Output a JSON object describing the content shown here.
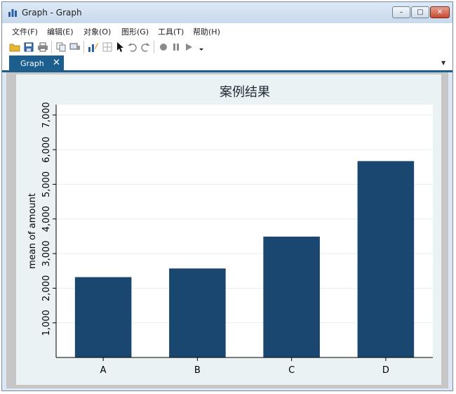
{
  "window": {
    "title": "Graph - Graph"
  },
  "window_controls": {
    "minimize": "–",
    "maximize": "□",
    "close": "✕"
  },
  "menu": [
    "文件(F)",
    "编辑(E)",
    "对象(O)",
    "图形(G)",
    "工具(T)",
    "帮助(H)"
  ],
  "toolbar_icons": [
    "open-folder-icon",
    "save-icon",
    "print-icon",
    "copy-icon",
    "screen-icon",
    "graph-editor-icon",
    "data-editor-icon",
    "pointer-icon",
    "undo-icon",
    "redo-icon",
    "record-icon",
    "pause-icon",
    "play-icon",
    "dropdown-icon"
  ],
  "tabs": [
    {
      "label": "Graph",
      "close": "✕"
    }
  ],
  "tab_menu": "▼",
  "colors": {
    "bar": "#1a476f",
    "panel": "#eaf2f3",
    "plot": "#ffffff",
    "tab": "#1c5f8f"
  },
  "chart_data": {
    "type": "bar",
    "title": "案例结果",
    "ylabel": "mean of amount",
    "xlabel": "",
    "categories": [
      "A",
      "B",
      "C",
      "D"
    ],
    "values": [
      2320,
      2570,
      3490,
      5670
    ],
    "ylim": [
      0,
      7300
    ],
    "yticks": [
      1000,
      2000,
      3000,
      4000,
      5000,
      6000,
      7000
    ],
    "ytick_labels": [
      "1,000",
      "2,000",
      "3,000",
      "4,000",
      "5,000",
      "6,000",
      "7,000"
    ],
    "grid": true
  }
}
